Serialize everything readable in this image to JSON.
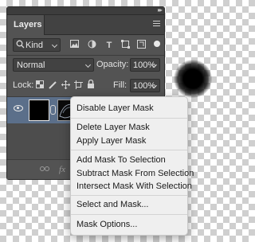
{
  "panel": {
    "tab_label": "Layers",
    "filter": {
      "value": "Kind",
      "icons": [
        "image-filter-icon",
        "adjustment-filter-icon",
        "type-filter-icon",
        "shape-filter-icon",
        "smart-object-filter-icon",
        "filter-toggle-icon"
      ]
    },
    "blend": {
      "mode": "Normal",
      "opacity_label": "Opacity:",
      "opacity_value": "100%"
    },
    "lock": {
      "label": "Lock:",
      "fill_label": "Fill:",
      "fill_value": "100%"
    },
    "bottom_icons": {
      "link": "link-layers-icon",
      "fx": "fx"
    }
  },
  "context_menu": {
    "items": [
      "Disable Layer Mask",
      "Delete Layer Mask",
      "Apply Layer Mask",
      "Add Mask To Selection",
      "Subtract Mask From Selection",
      "Intersect Mask With Selection",
      "Select and Mask...",
      "Mask Options..."
    ]
  },
  "colors": {
    "panel_bg": "#535353",
    "selected_layer": "#5b6f8a",
    "menu_bg": "#efefef"
  }
}
